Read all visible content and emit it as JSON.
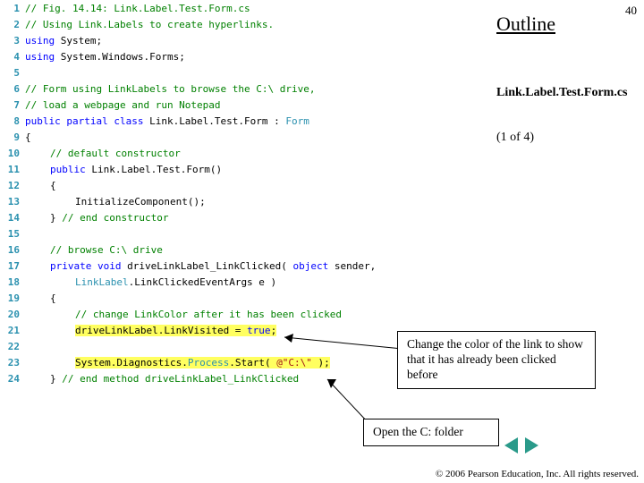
{
  "pageNumber": "40",
  "outline": "Outline",
  "fileName": "Link.Label.Test.Form.cs",
  "pageOf": "(1 of 4)",
  "code": {
    "l1": "// Fig. 14.14: Link.Label.Test.Form.cs",
    "l2": "// Using Link.Labels to create hyperlinks.",
    "l3a": "using",
    "l3b": " System;",
    "l4a": "using",
    "l4b": " System.Windows.Forms;",
    "l6": "// Form using LinkLabels to browse the C:\\ drive,",
    "l7": "// load a webpage and run Notepad",
    "l8a": "public partial class",
    "l8b": " Link.Label.Test.Form",
    "l8c": " : ",
    "l8d": "Form",
    "l9": "{",
    "l10": "// default constructor",
    "l11a": "public",
    "l11b": " Link.Label.Test.Form()",
    "l12": "{",
    "l13": "InitializeComponent();",
    "l14a": "} ",
    "l14b": "// end constructor",
    "l16": "// browse C:\\ drive",
    "l17a": "private void",
    "l17b": " driveLinkLabel_LinkClicked( ",
    "l17c": "object",
    "l17d": " sender,",
    "l18a": "LinkLabel",
    "l18b": ".LinkClickedEventArgs e )",
    "l19": "{",
    "l20": "// change LinkColor after it has been clicked",
    "l21a": "driveLinkLabel.LinkVisited = ",
    "l21b": "true",
    "l21c": ";",
    "l23a": "System.Diagnostics.",
    "l23b": "Process",
    "l23c": ".Start( ",
    "l23d": "@\"C:\\\"",
    "l23e": " );",
    "l24a": "} ",
    "l24b": "// end method driveLinkLabel_LinkClicked"
  },
  "callout1": "Change the color of the link to show that it has already been clicked before",
  "callout2": "Open the C: folder",
  "copyright": "© 2006 Pearson Education, Inc.  All rights reserved."
}
